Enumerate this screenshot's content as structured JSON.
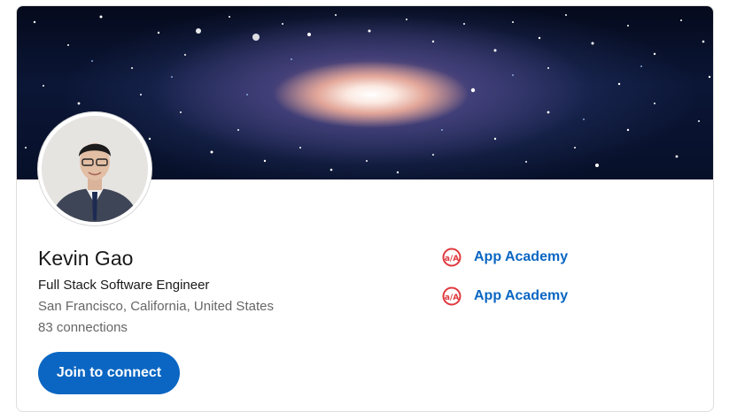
{
  "profile": {
    "name": "Kevin Gao",
    "headline": "Full Stack Software Engineer",
    "location": "San Francisco, California, United States",
    "connections": "83 connections"
  },
  "actions": {
    "join_label": "Join to connect"
  },
  "education": [
    {
      "label": "App Academy",
      "icon": "app-academy-logo-icon"
    },
    {
      "label": "App Academy",
      "icon": "app-academy-logo-icon"
    }
  ],
  "colors": {
    "accent": "#0a66c2",
    "logo_red": "#e0393e",
    "text_primary": "#191919",
    "text_secondary": "#666666"
  }
}
